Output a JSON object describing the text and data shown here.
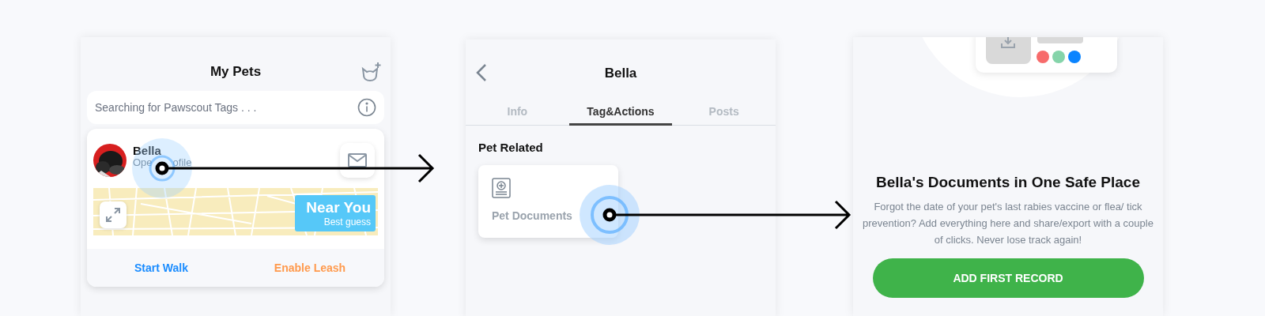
{
  "pets_screen": {
    "title": "My Pets",
    "status_text": "Searching for Pawscout Tags . . .",
    "pet": {
      "name": "Bella",
      "subtitle_start": "Ope",
      "subtitle_end": "ofile",
      "badge_title": "Near You",
      "badge_subtitle": "Best guess"
    },
    "actions": [
      {
        "label": "Start Walk",
        "color": "#1a8cff"
      },
      {
        "label": "Enable Leash",
        "color": "#ff9a4d"
      }
    ]
  },
  "pet_screen": {
    "title": "Bella",
    "tabs": [
      {
        "label": "Info",
        "selected": false
      },
      {
        "label": "Tag&Actions",
        "selected": true
      },
      {
        "label": "Posts",
        "selected": false
      }
    ],
    "section_title": "Pet Related",
    "tile_label": "Pet Documents"
  },
  "documents_screen": {
    "dots": [
      {
        "color": "#f76b6b"
      },
      {
        "color": "#85d4aa"
      },
      {
        "color": "#0a84ff"
      }
    ],
    "title": "Bella's Documents in One Safe Place",
    "description": "Forgot the date of your pet's last rabies vaccine or flea/ tick prevention? Add everything here and share/export with a couple of clicks. Never lose track again!",
    "button": "ADD FIRST RECORD"
  }
}
